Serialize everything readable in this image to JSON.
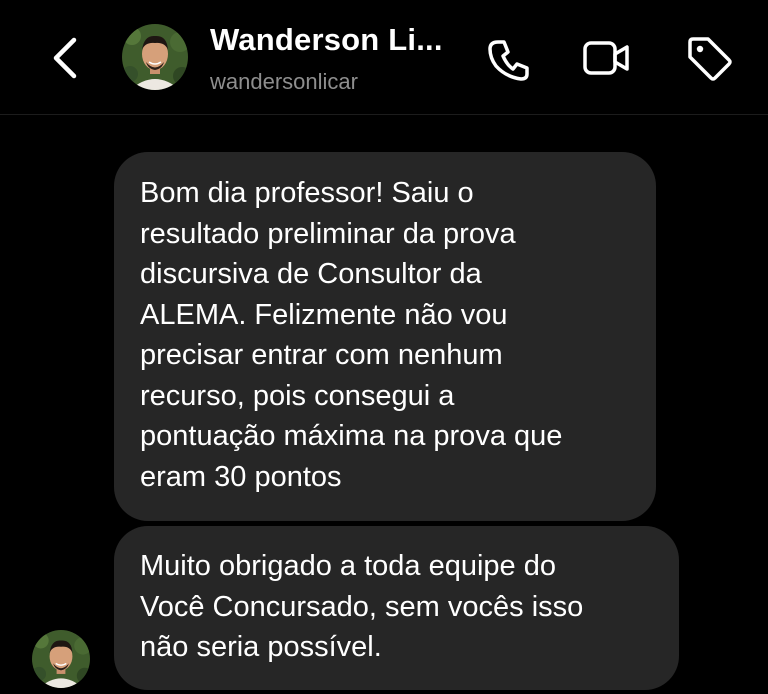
{
  "header": {
    "name": "Wanderson Li...",
    "username": "wandersonlicar",
    "icons": {
      "back": "chevron-left-icon",
      "call": "phone-icon",
      "video": "video-camera-icon",
      "tag": "tag-icon"
    }
  },
  "messages": [
    {
      "lines": [
        "Bom dia professor! Saiu o",
        "resultado preliminar da prova",
        "discursiva de Consultor da",
        "ALEMA. Felizmente não vou",
        "precisar entrar com nenhum",
        "recurso, pois consegui a",
        "pontuação máxima na prova que",
        "eram 30 pontos"
      ]
    },
    {
      "lines": [
        "Muito obrigado a toda equipe do",
        "Você Concursado, sem vocês isso",
        "não seria possível."
      ]
    }
  ],
  "colors": {
    "background": "#000000",
    "bubble": "#262626",
    "text": "#ffffff",
    "secondary_text": "#8e8e8e"
  }
}
